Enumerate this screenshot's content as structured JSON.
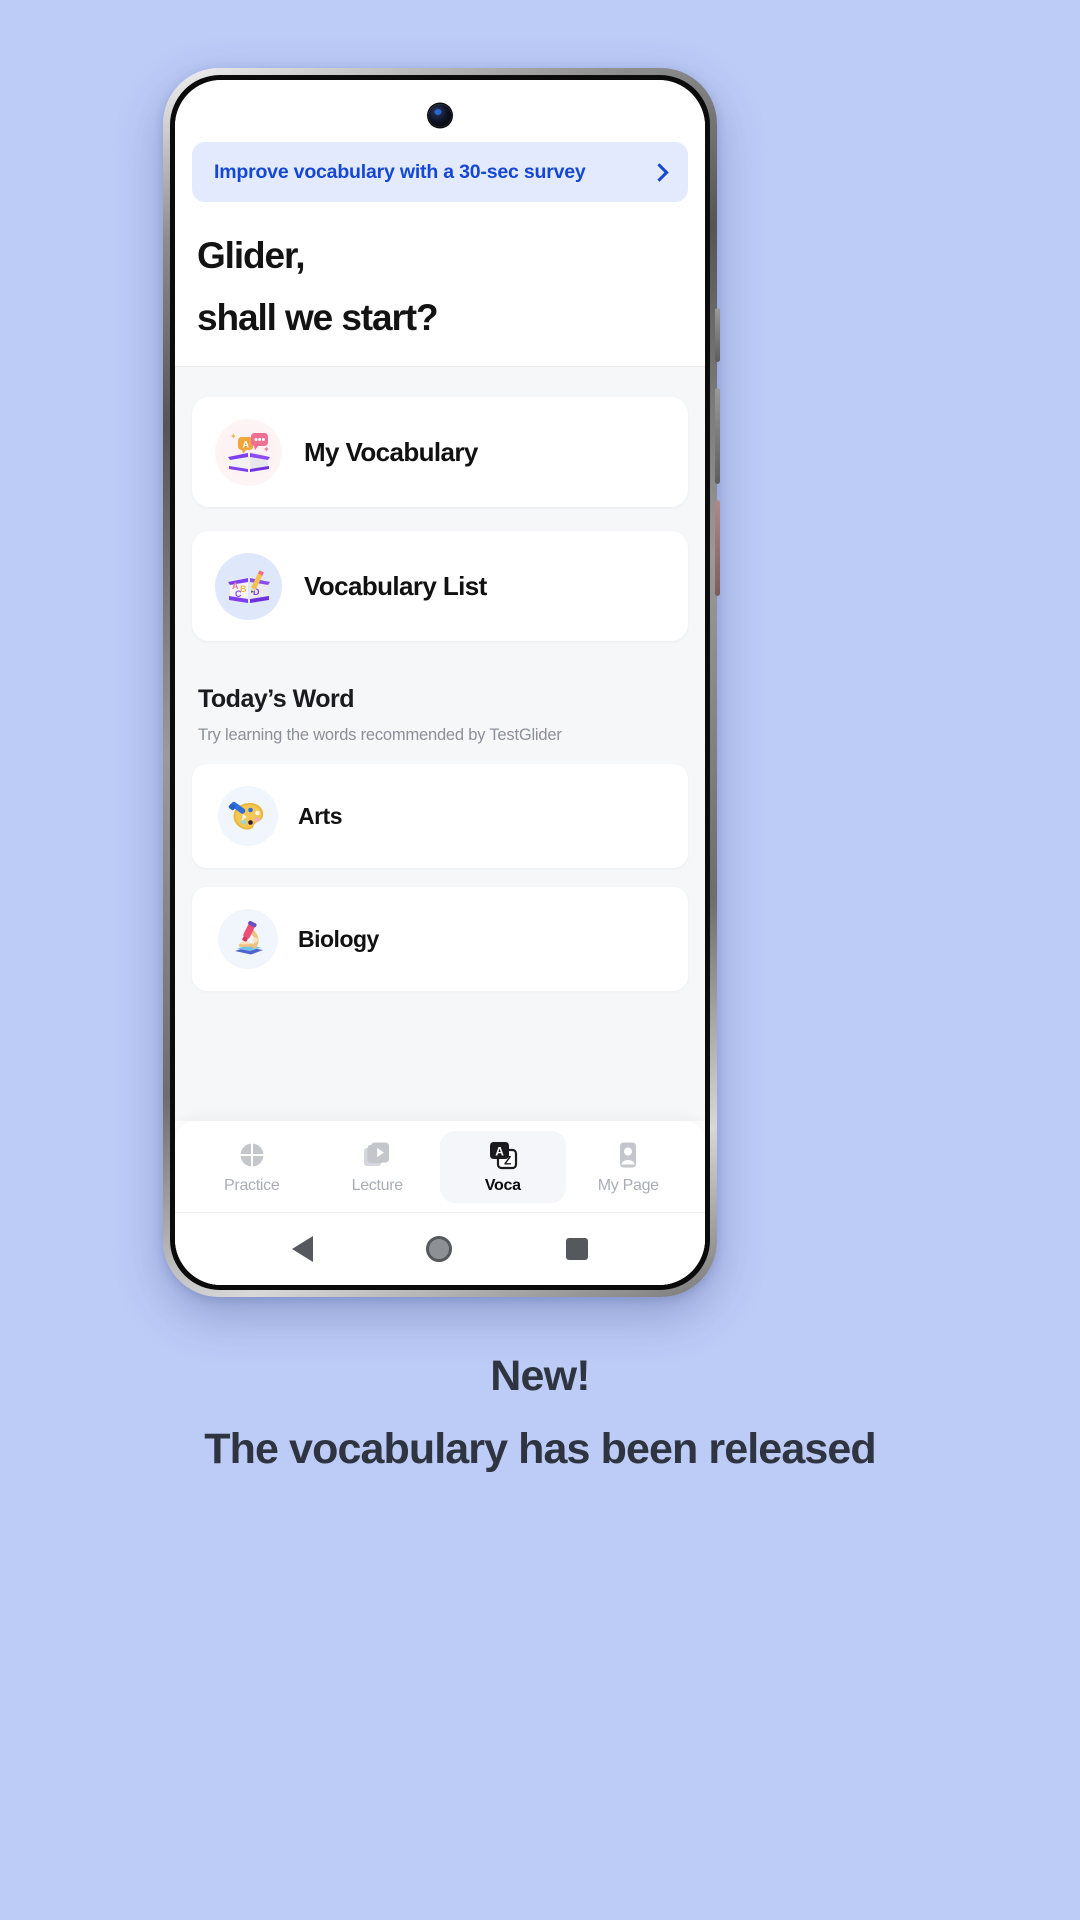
{
  "background_color": "#bdcbf7",
  "banner": {
    "text": "Improve vocabulary with a 30-sec survey",
    "chevron_icon": "chevron-right-icon",
    "accent_color": "#1447d6",
    "background_color": "#e3eafd"
  },
  "greeting": {
    "line1": "Glider,",
    "line2": "shall we start?"
  },
  "menu_cards": [
    {
      "label": "My Vocabulary",
      "icon": "open-book-speech-bubbles-icon"
    },
    {
      "label": "Vocabulary List",
      "icon": "open-book-abcd-pencil-icon"
    }
  ],
  "todays_word": {
    "title": "Today’s Word",
    "subtitle": "Try learning the words recommended by TestGlider",
    "items": [
      {
        "label": "Arts",
        "icon": "artist-palette-icon"
      },
      {
        "label": "Biology",
        "icon": "microscope-icon"
      }
    ]
  },
  "tabbar": {
    "tabs": [
      {
        "label": "Practice",
        "icon": "practice-circle-icon",
        "active": false
      },
      {
        "label": "Lecture",
        "icon": "lecture-video-icon",
        "active": false
      },
      {
        "label": "Voca",
        "icon": "translate-a-z-icon",
        "active": true
      },
      {
        "label": "My Page",
        "icon": "person-card-icon",
        "active": false
      }
    ]
  },
  "android_nav": {
    "back": "back-triangle-icon",
    "home": "home-circle-icon",
    "recents": "recents-square-icon"
  },
  "caption": {
    "line1": "New!",
    "line2": "The vocabulary has been released"
  }
}
